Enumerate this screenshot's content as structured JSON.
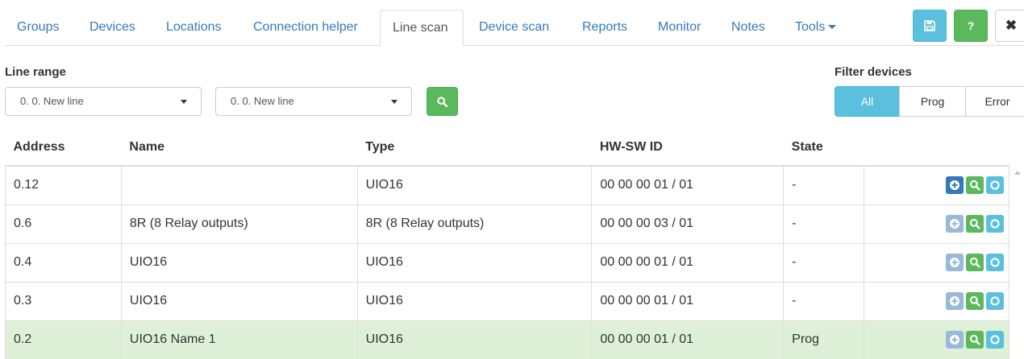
{
  "nav": {
    "tabs": [
      {
        "label": "Groups",
        "active": false
      },
      {
        "label": "Devices",
        "active": false
      },
      {
        "label": "Locations",
        "active": false
      },
      {
        "label": "Connection helper",
        "active": false
      },
      {
        "label": "Line scan",
        "active": true
      },
      {
        "label": "Device scan",
        "active": false
      },
      {
        "label": "Reports",
        "active": false
      },
      {
        "label": "Monitor",
        "active": false
      },
      {
        "label": "Notes",
        "active": false
      },
      {
        "label": "Tools",
        "active": false
      }
    ],
    "help_label": "?",
    "close_label": "✖"
  },
  "line_range": {
    "label": "Line range",
    "from_value": "0. 0. New line",
    "to_value": "0. 0. New line"
  },
  "filter": {
    "label": "Filter devices",
    "options": [
      "All",
      "Prog",
      "Error"
    ],
    "selected": "All"
  },
  "table": {
    "headers": [
      "Address",
      "Name",
      "Type",
      "HW-SW ID",
      "State"
    ],
    "rows": [
      {
        "address": "0.12",
        "name": "",
        "type": "UIO16",
        "hwsw": "00 00 00 01 / 01",
        "state": "-"
      },
      {
        "address": "0.6",
        "name": "8R (8 Relay outputs)",
        "type": "8R (8 Relay outputs)",
        "hwsw": "00 00 00 03 / 01",
        "state": "-"
      },
      {
        "address": "0.4",
        "name": "UIO16",
        "type": "UIO16",
        "hwsw": "00 00 00 01 / 01",
        "state": "-"
      },
      {
        "address": "0.3",
        "name": "UIO16",
        "type": "UIO16",
        "hwsw": "00 00 00 01 / 01",
        "state": "-"
      },
      {
        "address": "0.2",
        "name": "UIO16 Name 1",
        "type": "UIO16",
        "hwsw": "00 00 00 01 / 01",
        "state": "Prog"
      }
    ]
  },
  "colors": {
    "primary": "#337ab7",
    "success": "#5cb85c",
    "info": "#5bc0de",
    "highlight_row": "#dff0d8"
  },
  "icons": {
    "save": "floppy-disk-icon",
    "add": "plus-circle-icon",
    "search": "search-icon",
    "ring": "circle-icon"
  }
}
